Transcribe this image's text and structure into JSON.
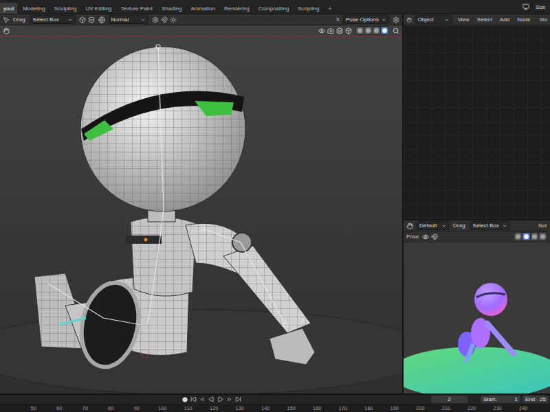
{
  "topbar": {
    "tabs": [
      {
        "label": "yout",
        "selected": true
      },
      {
        "label": "Modeling",
        "selected": false
      },
      {
        "label": "Sculpting",
        "selected": false
      },
      {
        "label": "UV Editing",
        "selected": false
      },
      {
        "label": "Texture Paint",
        "selected": false
      },
      {
        "label": "Shading",
        "selected": false
      },
      {
        "label": "Animation",
        "selected": false
      },
      {
        "label": "Rendering",
        "selected": false
      },
      {
        "label": "Compositing",
        "selected": false
      },
      {
        "label": "Scripting",
        "selected": false
      }
    ],
    "add_tab": "+",
    "scene": "Sce"
  },
  "viewport": {
    "tool_header": {
      "drag_label": "Drag:",
      "drag_mode": "Select Box",
      "orientation": "Normal",
      "mirror_label": "X",
      "pose_options": "Pose Options"
    },
    "shading": [
      {
        "selected": false
      },
      {
        "selected": false
      },
      {
        "selected": false
      },
      {
        "selected": true
      }
    ]
  },
  "node_editor": {
    "object_type": "Object",
    "menus": [
      "View",
      "Select",
      "Add",
      "Node"
    ],
    "slot": "Slo"
  },
  "preview": {
    "transform": "Default",
    "drag_label": "Drag:",
    "drag_mode": "Select Box",
    "orientation": "Nor",
    "mode": "Pose",
    "shading": [
      {
        "selected": false
      },
      {
        "selected": true
      },
      {
        "selected": false
      },
      {
        "selected": false
      }
    ]
  },
  "timeline": {
    "current_frame": "2",
    "start_label": "Start:",
    "start": "1",
    "end_label": "End",
    "end": "25",
    "ruler": [
      "50",
      "60",
      "70",
      "80",
      "90",
      "100",
      "110",
      "120",
      "130",
      "140",
      "150",
      "160",
      "170",
      "180",
      "190",
      "200",
      "210",
      "220",
      "230",
      "240"
    ]
  }
}
